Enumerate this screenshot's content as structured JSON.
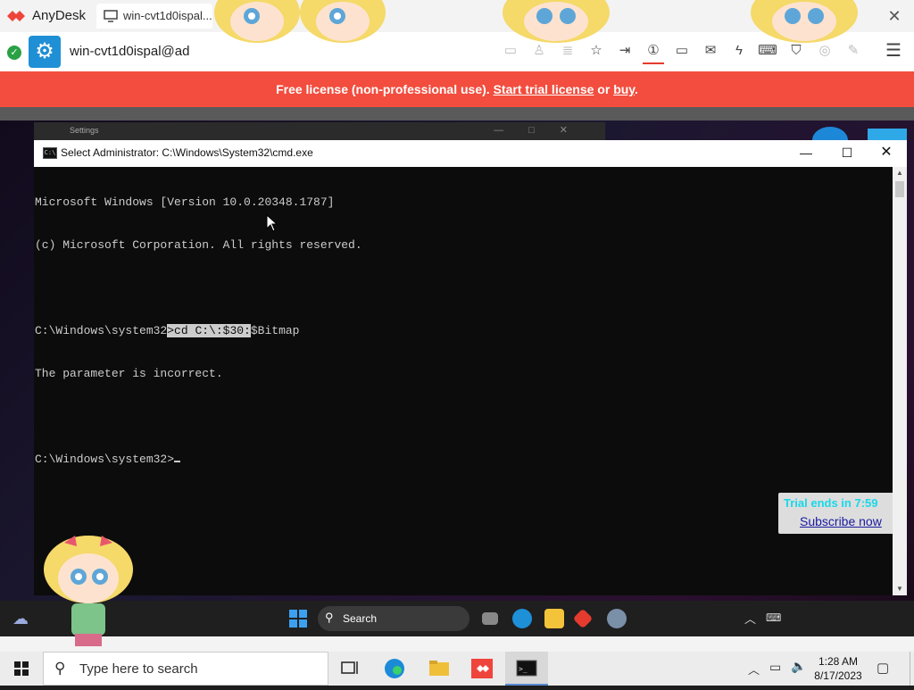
{
  "anydesk": {
    "app_name": "AnyDesk",
    "tab_label": "win-cvt1d0ispal...",
    "remote_name": "win-cvt1d0ispal@ad",
    "accent_color": "#ef443b",
    "toolbar_icons": [
      "display-icon",
      "user-icon",
      "database-icon",
      "star-icon",
      "file-transfer-icon",
      "monitor-1-icon",
      "screen-icon",
      "chat-icon",
      "lightning-icon",
      "keyboard-icon",
      "shield-icon",
      "record-icon",
      "pen-icon"
    ],
    "menu_icon": "hamburger-icon"
  },
  "banner": {
    "prefix": "Free license (non-professional use).",
    "trial_link": "Start trial license",
    "mid": "or",
    "buy_link": "buy",
    "suffix": ".",
    "color": "#f24d3e"
  },
  "remote": {
    "settings_title": "Settings",
    "cmd": {
      "title": "Select Administrator: C:\\Windows\\System32\\cmd.exe",
      "line1": "Microsoft Windows [Version 10.0.20348.1787]",
      "line2": "(c) Microsoft Corporation. All rights reserved.",
      "line3_prompt": "C:\\Windows\\system32",
      "line3_selected": ">cd C:\\:$30:",
      "line3_rest": "$Bitmap",
      "line4": "The parameter is incorrect.",
      "line5_prompt": "C:\\Windows\\system32>"
    },
    "taskbar": {
      "search_label": "Search",
      "promo_trial": "Trial ends in 7:59",
      "promo_subscribe": "Subscribe now"
    }
  },
  "taskbar": {
    "search_placeholder": "Type here to search",
    "time": "1:28 AM",
    "date": "8/17/2023"
  }
}
